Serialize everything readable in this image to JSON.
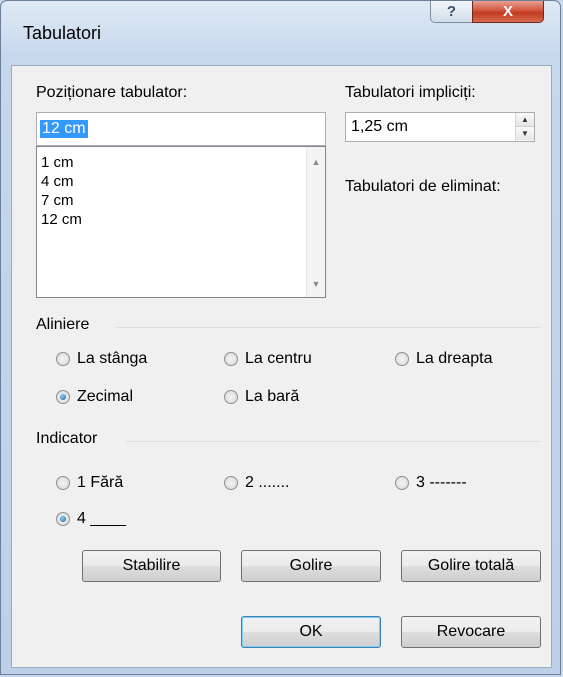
{
  "window": {
    "title": "Tabulatori",
    "help_glyph": "?",
    "close_glyph": "X"
  },
  "tab_position": {
    "label": "Poziționare tabulator:",
    "value": "12 cm",
    "items": [
      "1 cm",
      "4 cm",
      "7 cm",
      "12 cm"
    ]
  },
  "default_tabs": {
    "label": "Tabulatori impliciți:",
    "value": "1,25 cm"
  },
  "tabs_to_clear": {
    "label": "Tabulatori de eliminat:"
  },
  "alignment": {
    "label": "Aliniere",
    "options": [
      "La stânga",
      "La centru",
      "La dreapta",
      "Zecimal",
      "La bară"
    ],
    "selected": "Zecimal"
  },
  "leader": {
    "label": "Indicator",
    "options": [
      "1 Fără",
      "2 .......",
      "3 -------",
      "4 ____"
    ],
    "selected": "4 ____"
  },
  "buttons": {
    "set": "Stabilire",
    "clear": "Golire",
    "clear_all": "Golire totală",
    "ok": "OK",
    "cancel": "Revocare"
  }
}
